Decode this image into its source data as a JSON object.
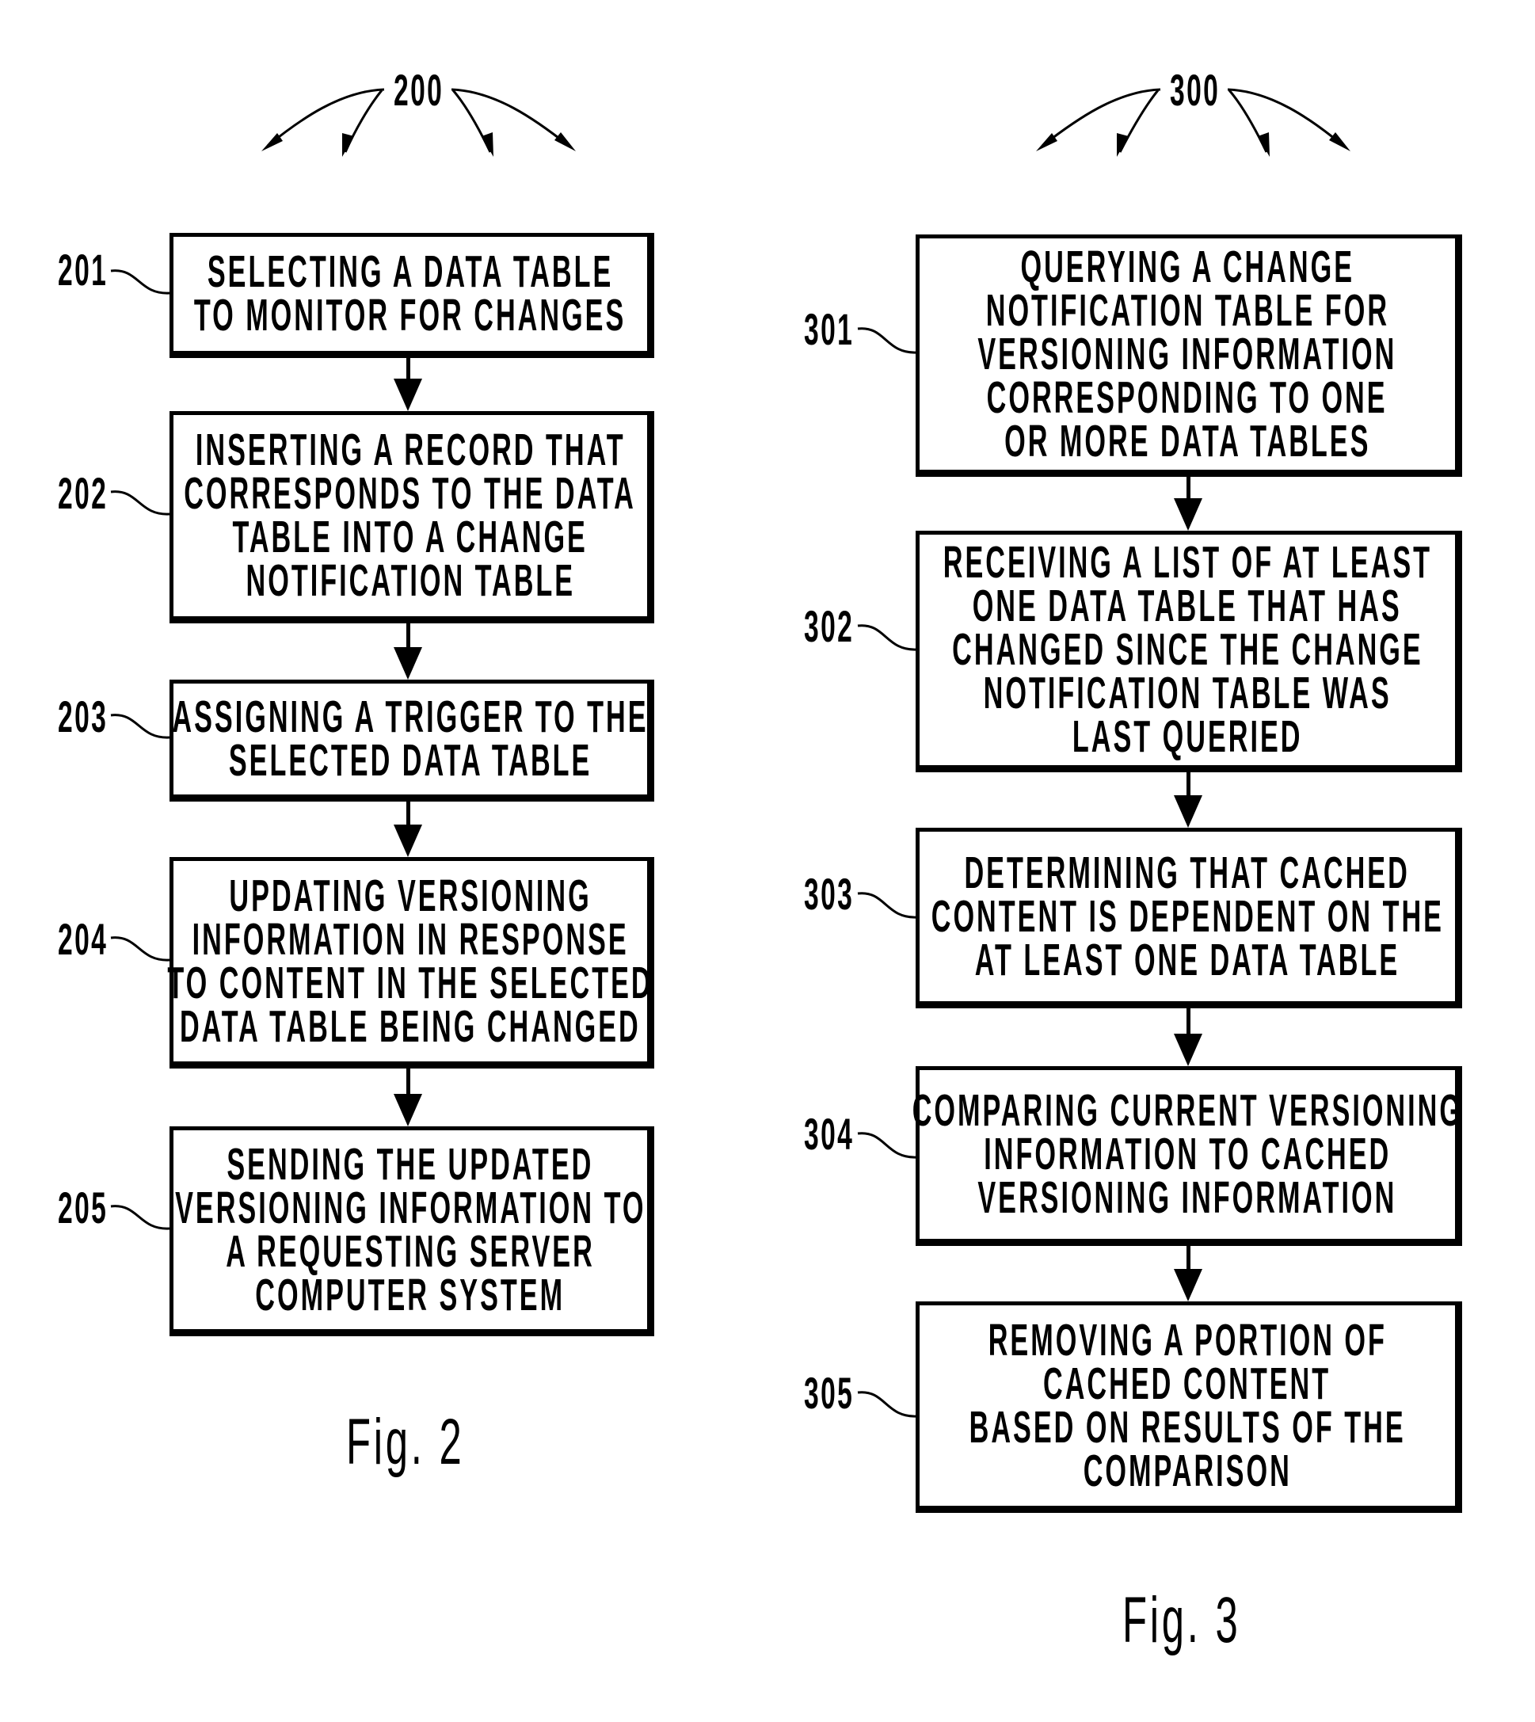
{
  "figures": [
    {
      "id": "fig2",
      "caption": "Fig.  2",
      "reference": "200",
      "steps": [
        {
          "ref": "201",
          "lines": [
            "SELECTING A DATA TABLE",
            "TO MONITOR FOR CHANGES"
          ]
        },
        {
          "ref": "202",
          "lines": [
            "INSERTING A RECORD THAT",
            "CORRESPONDS TO THE DATA",
            "TABLE INTO A CHANGE",
            "NOTIFICATION TABLE"
          ]
        },
        {
          "ref": "203",
          "lines": [
            "ASSIGNING A TRIGGER TO THE",
            "SELECTED DATA TABLE"
          ]
        },
        {
          "ref": "204",
          "lines": [
            "UPDATING VERSIONING",
            "INFORMATION IN RESPONSE",
            "TO CONTENT IN THE SELECTED",
            "DATA TABLE BEING CHANGED"
          ]
        },
        {
          "ref": "205",
          "lines": [
            "SENDING THE UPDATED",
            "VERSIONING INFORMATION TO",
            "A REQUESTING SERVER",
            "COMPUTER SYSTEM"
          ]
        }
      ]
    },
    {
      "id": "fig3",
      "caption": "Fig.  3",
      "reference": "300",
      "steps": [
        {
          "ref": "301",
          "lines": [
            "QUERYING A CHANGE",
            "NOTIFICATION TABLE FOR",
            "VERSIONING INFORMATION",
            "CORRESPONDING TO ONE",
            "OR MORE DATA TABLES"
          ]
        },
        {
          "ref": "302",
          "lines": [
            "RECEIVING A LIST OF AT LEAST",
            "ONE DATA TABLE THAT HAS",
            "CHANGED SINCE THE CHANGE",
            "NOTIFICATION TABLE WAS",
            "LAST QUERIED"
          ]
        },
        {
          "ref": "303",
          "lines": [
            "DETERMINING THAT CACHED",
            "CONTENT IS DEPENDENT ON THE",
            "AT LEAST ONE DATA TABLE"
          ]
        },
        {
          "ref": "304",
          "lines": [
            "COMPARING CURRENT VERSIONING",
            "INFORMATION TO CACHED",
            "VERSIONING INFORMATION"
          ]
        },
        {
          "ref": "305",
          "lines": [
            "REMOVING A PORTION OF",
            "CACHED CONTENT",
            "BASED ON RESULTS OF THE",
            "COMPARISON"
          ]
        }
      ]
    }
  ]
}
